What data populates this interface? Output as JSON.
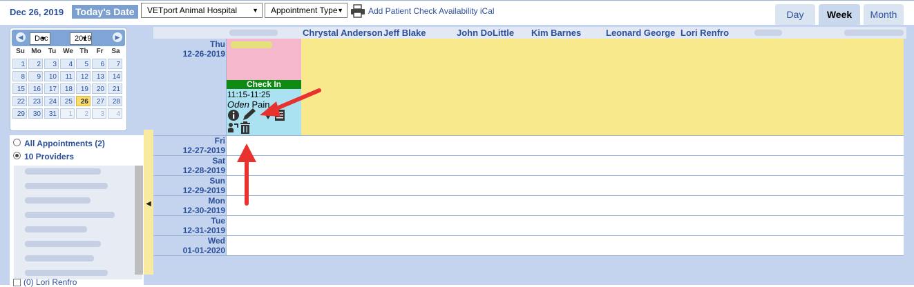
{
  "header": {
    "date_label": "Dec 26, 2019",
    "today_button": "Today's Date",
    "clinic_select": "VETport Animal Hospital",
    "appointment_type_select": "Appointment Type",
    "links": "Add Patient Check Availability iCal",
    "view_tabs": {
      "day": "Day",
      "week": "Week",
      "month": "Month"
    }
  },
  "mini_calendar": {
    "month": "Dec",
    "year": "2019",
    "dow": [
      "Su",
      "Mo",
      "Tu",
      "We",
      "Th",
      "Fr",
      "Sa"
    ],
    "weeks": [
      [
        "1",
        "2",
        "3",
        "4",
        "5",
        "6",
        "7"
      ],
      [
        "8",
        "9",
        "10",
        "11",
        "12",
        "13",
        "14"
      ],
      [
        "15",
        "16",
        "17",
        "18",
        "19",
        "20",
        "21"
      ],
      [
        "22",
        "23",
        "24",
        "25",
        "26",
        "27",
        "28"
      ],
      [
        "29",
        "30",
        "31",
        "1",
        "2",
        "3",
        "4"
      ]
    ],
    "today": "26"
  },
  "filters": {
    "all_appointments": "All Appointments (2)",
    "providers": "10 Providers",
    "last_provider": "(0) Lori Renfro"
  },
  "providers": [
    "Chrystal Anderson",
    "Jeff Blake",
    "John DoLittle",
    "Kim Barnes",
    "Leonard George",
    "Lori Renfro"
  ],
  "days": [
    {
      "dow": "Thu",
      "date": "12-26-2019"
    },
    {
      "dow": "Fri",
      "date": "12-27-2019"
    },
    {
      "dow": "Sat",
      "date": "12-28-2019"
    },
    {
      "dow": "Sun",
      "date": "12-29-2019"
    },
    {
      "dow": "Mon",
      "date": "12-30-2019"
    },
    {
      "dow": "Tue",
      "date": "12-31-2019"
    },
    {
      "dow": "Wed",
      "date": "01-01-2020"
    }
  ],
  "appointment": {
    "status": "Check In",
    "time": "11:15-11:25",
    "patient": "Oden",
    "reason": "Pain"
  },
  "colors": {
    "accent": "#2b4f9a",
    "today_highlight": "#f8e98c",
    "checkin_green": "#0e8a12",
    "appointment_bg": "#abe2f2",
    "annotation_red": "#e8322f"
  }
}
